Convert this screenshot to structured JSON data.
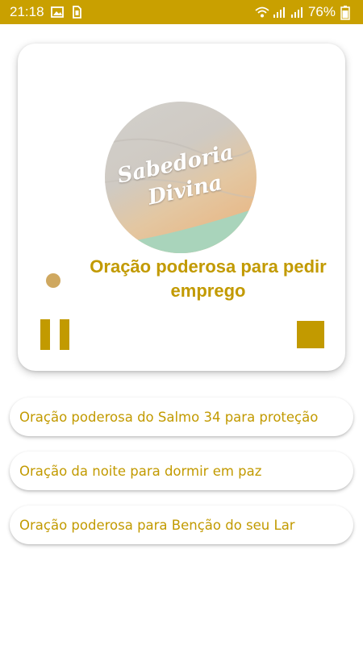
{
  "status_bar": {
    "time": "21:18",
    "battery": "76%",
    "icons": [
      "image-icon",
      "sim-icon",
      "wifi-icon",
      "signal-icon",
      "signal-icon",
      "battery-icon"
    ]
  },
  "player": {
    "cover_line1": "Sabedoria",
    "cover_line2": "Divina",
    "title": "Oração poderosa para pedir emprego",
    "pause_icon": "pause-icon",
    "stop_icon": "stop-icon"
  },
  "prayers": [
    {
      "label": "Oração poderosa do Salmo 34 para proteção"
    },
    {
      "label": "Oração da noite para dormir em paz"
    },
    {
      "label": "Oração poderosa para Benção do seu Lar"
    }
  ],
  "colors": {
    "accent": "#c29a00",
    "status_bar": "#c9a000",
    "progress_dot": "#cfa860"
  }
}
